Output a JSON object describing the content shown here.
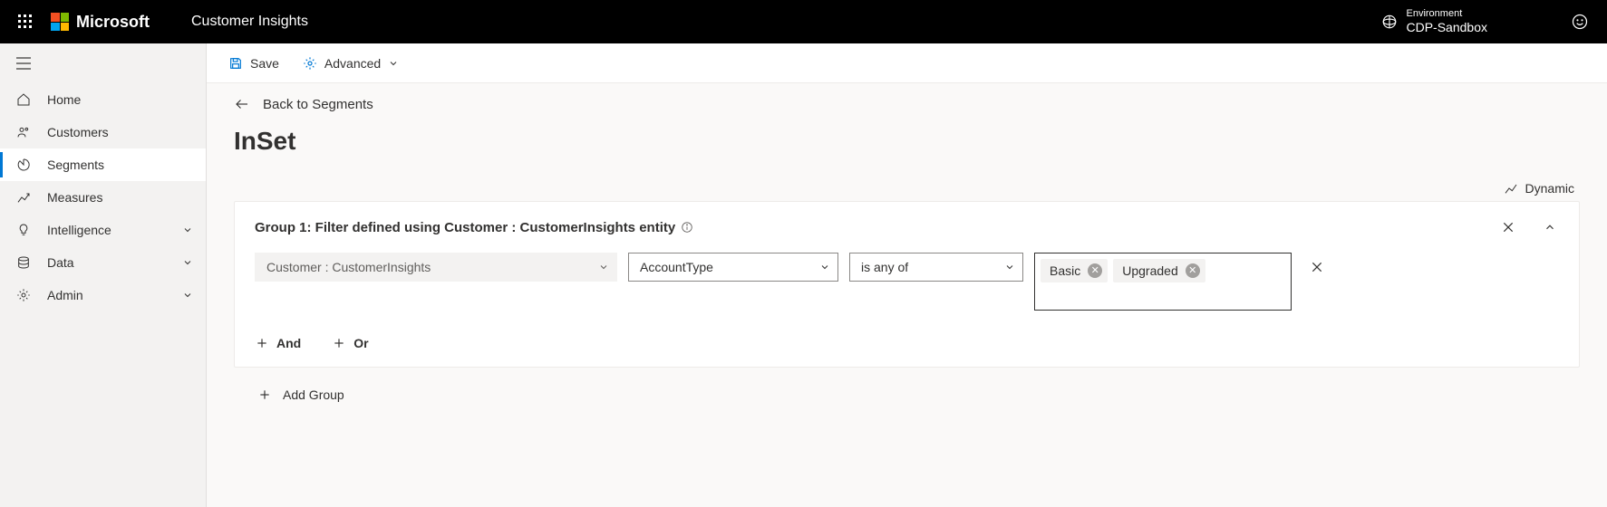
{
  "header": {
    "brand": "Microsoft",
    "app_name": "Customer Insights",
    "environment_label": "Environment",
    "environment_name": "CDP-Sandbox"
  },
  "sidebar": {
    "items": [
      {
        "label": "Home"
      },
      {
        "label": "Customers"
      },
      {
        "label": "Segments"
      },
      {
        "label": "Measures"
      },
      {
        "label": "Intelligence",
        "expandable": true
      },
      {
        "label": "Data",
        "expandable": true
      },
      {
        "label": "Admin",
        "expandable": true
      }
    ]
  },
  "cmdbar": {
    "save_label": "Save",
    "advanced_label": "Advanced"
  },
  "page": {
    "back_link": "Back to Segments",
    "title": "InSet",
    "dynamic_label": "Dynamic"
  },
  "group": {
    "title": "Group 1: Filter defined using Customer : CustomerInsights entity",
    "entity_select": "Customer : CustomerInsights",
    "attribute_select": "AccountType",
    "operator_select": "is any of",
    "values": {
      "v0": "Basic",
      "v1": "Upgraded"
    },
    "and_label": "And",
    "or_label": "Or"
  },
  "add_group_label": "Add Group"
}
